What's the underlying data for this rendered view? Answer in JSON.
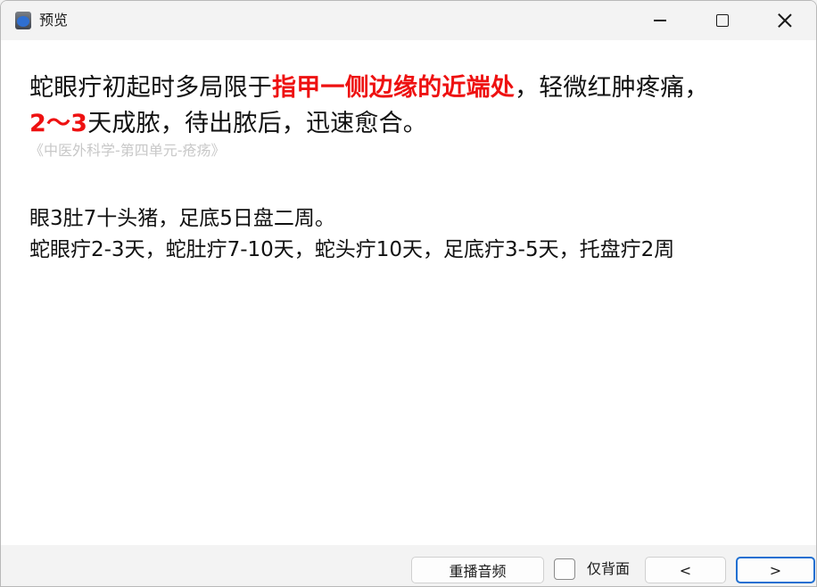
{
  "window": {
    "title": "预览",
    "app_icon": "app-star-icon",
    "controls": [
      "minimize-icon",
      "maximize-icon",
      "close-icon"
    ]
  },
  "card": {
    "main_part1": "蛇眼疔初起时多局限于",
    "main_highlight1": "指甲一侧边缘的近端处",
    "main_part2": "，轻微红肿疼痛，",
    "main_highlight2": "2～3",
    "main_part3": "天成脓，待出脓后，迅速愈合。",
    "source": "《中医外科学-第四单元-疮疡》",
    "memo_line1": "眼3肚7十头猪，足底5日盘二周。",
    "memo_line2": "蛇眼疔2-3天，蛇肚疔7-10天，蛇头疔10天，足底疔3-5天，托盘疔2周"
  },
  "footer": {
    "replay_label": "重播音频",
    "back_only_label": "仅背面",
    "back_only_checked": false,
    "prev_label": "<",
    "next_label": ">"
  },
  "colors": {
    "highlight": "#ee1111",
    "accent": "#1f6fd1"
  }
}
